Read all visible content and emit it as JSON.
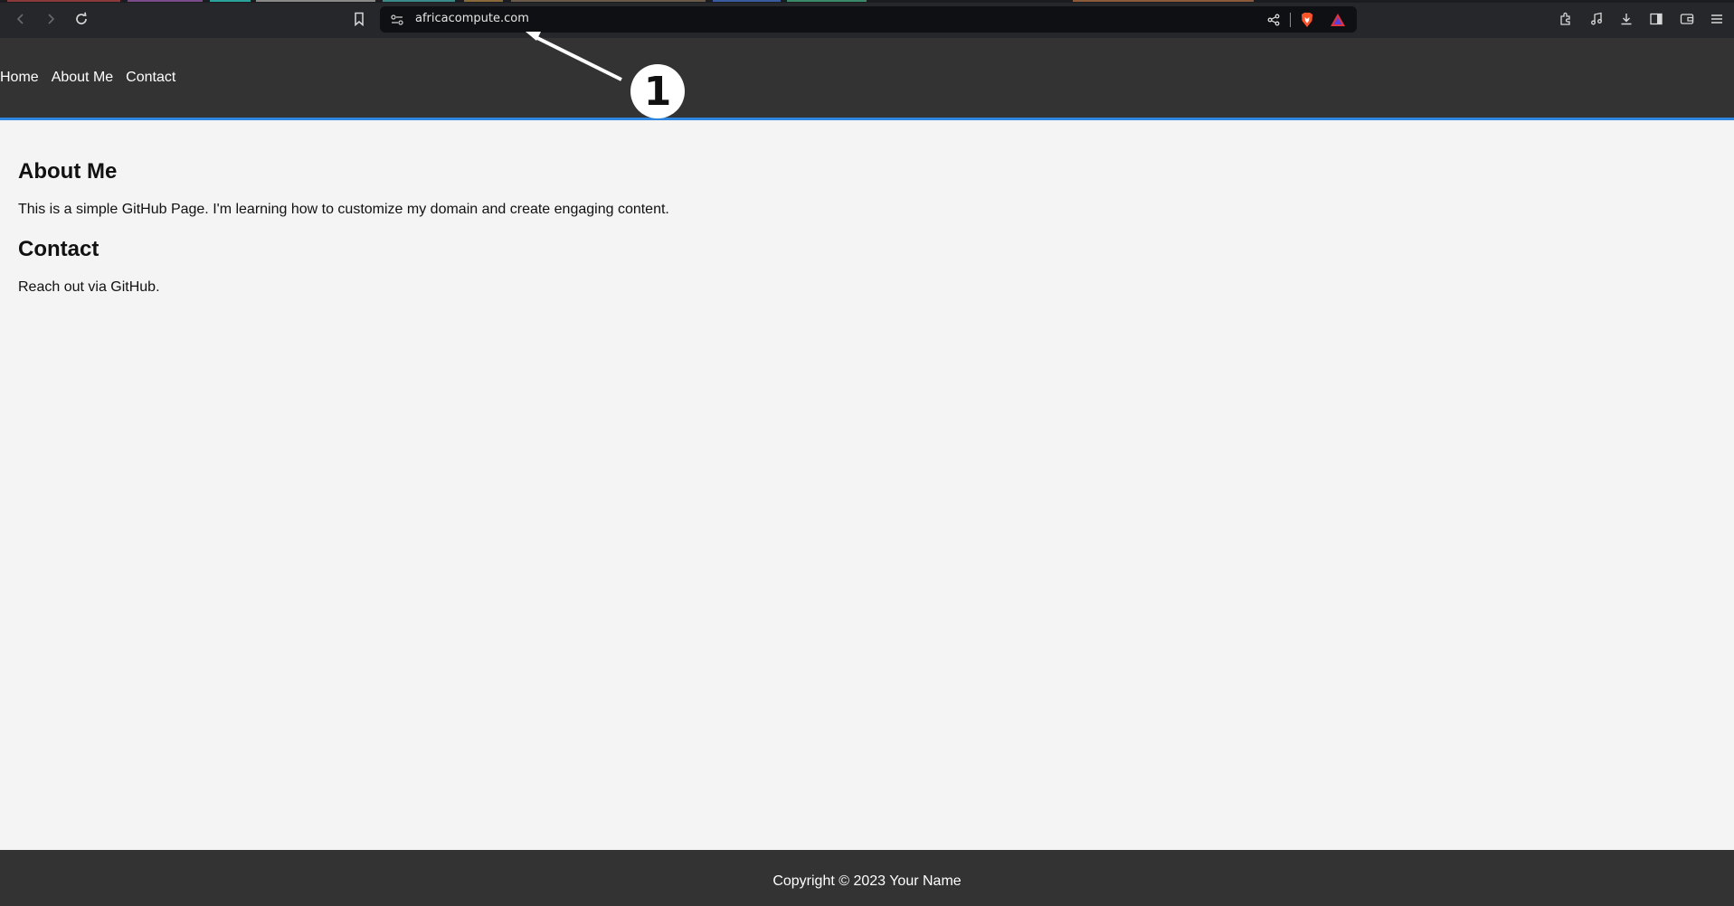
{
  "browser": {
    "url": "africacompute.com",
    "icons": {
      "back": "back-arrow-icon",
      "forward": "forward-arrow-icon",
      "reload": "reload-icon",
      "bookmark": "bookmark-icon",
      "site_settings": "site-settings-icon",
      "share": "share-icon",
      "brave_shields": "brave-shields-icon",
      "brave_rewards": "brave-rewards-icon",
      "extensions": "extensions-icon",
      "media": "media-icon",
      "downloads": "downloads-icon",
      "sidebar": "sidebar-icon",
      "wallet": "wallet-icon",
      "menu": "menu-icon"
    }
  },
  "site": {
    "nav": [
      "Home",
      "About Me",
      "Contact"
    ],
    "sections": [
      {
        "heading": "About Me",
        "text": "This is a simple GitHub Page. I'm learning how to customize my domain and create engaging content."
      },
      {
        "heading": "Contact",
        "text": "Reach out via GitHub."
      }
    ],
    "footer": "Copyright © 2023 Your Name"
  },
  "annotation": {
    "label": "1"
  },
  "colors": {
    "header_bg": "#333333",
    "header_border": "#2f86e0",
    "page_bg": "#f4f4f4",
    "chrome_bg": "#26272b",
    "urlbar_bg": "#0f1014"
  }
}
